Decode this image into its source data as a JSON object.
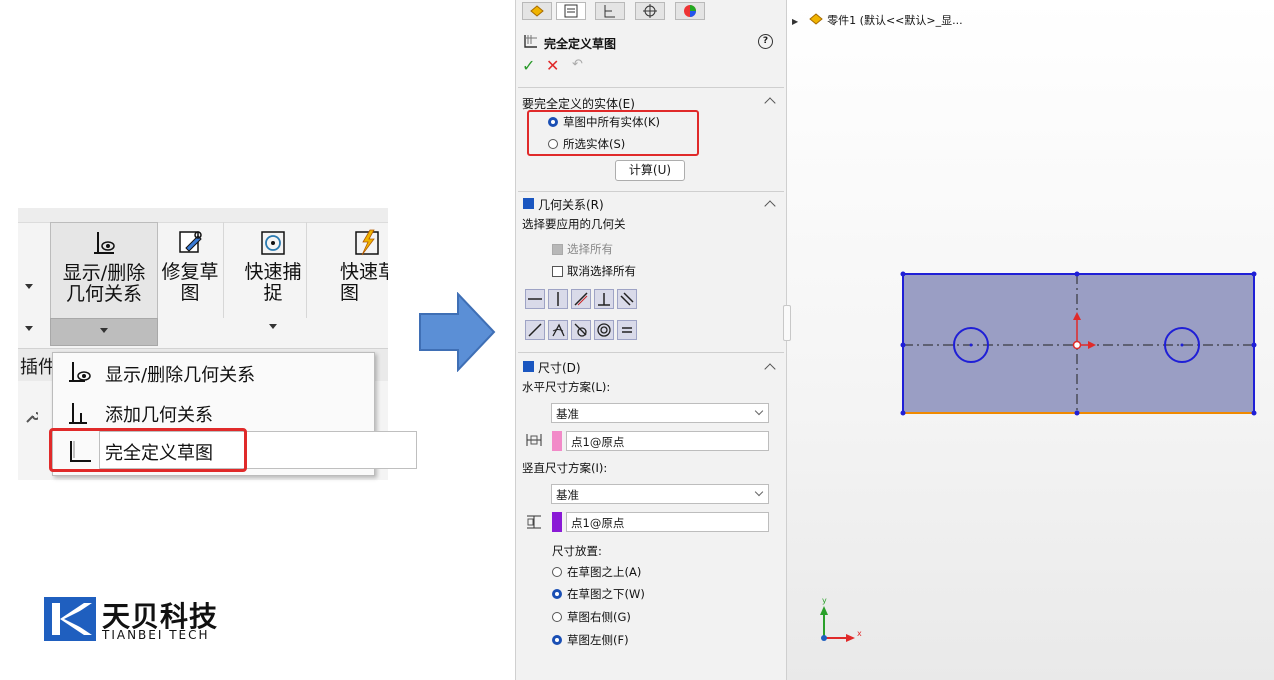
{
  "ribbon": {
    "show_delete_label_1": "显示/删除",
    "show_delete_label_2": "几何关系",
    "repair_label_1": "修复草",
    "repair_label_2": "图",
    "quick_snap_label_1": "快速捕",
    "quick_snap_label_2": "捉",
    "quick_sketch_label_1": "快速草",
    "quick_sketch_label_2": "图",
    "strip_text": "插件"
  },
  "dropdown_menu": {
    "items": [
      {
        "label": "显示/删除几何关系"
      },
      {
        "label": "添加几何关系"
      },
      {
        "label": "完全定义草图"
      }
    ]
  },
  "logo": {
    "cn": "天贝科技",
    "en": "TIANBEI TECH"
  },
  "pm": {
    "title": "完全定义草图",
    "help": "?",
    "section_entities": {
      "title": "要完全定义的实体(E)",
      "option_all": "草图中所有实体(K)",
      "option_selected": "所选实体(S)",
      "calc_button": "计算(U)"
    },
    "section_relations": {
      "title": "几何关系(R)",
      "prompt": "选择要应用的几何关",
      "select_all": "选择所有",
      "deselect_all": "取消选择所有"
    },
    "section_dimensions": {
      "title": "尺寸(D)",
      "h_scheme_label": "水平尺寸方案(L):",
      "h_scheme_value": "基准",
      "h_origin": "点1@原点",
      "v_scheme_label": "竖直尺寸方案(I):",
      "v_scheme_value": "基准",
      "v_origin": "点1@原点",
      "placement_label": "尺寸放置:",
      "above": "在草图之上(A)",
      "below": "在草图之下(W)",
      "right": "草图右侧(G)",
      "left": "草图左侧(F)"
    }
  },
  "graphics": {
    "tree_text": "零件1  (默认<<默认>_显...",
    "axis_x": "x",
    "axis_y": "y"
  },
  "colors": {
    "highlight_red": "#e02a2a",
    "sketch_blue": "#1f1fd6",
    "sketch_fill": "#9a9ec4",
    "orange_edge": "#f08a00",
    "h_swatch": "#f28ac8",
    "v_swatch": "#8a1ad6"
  }
}
